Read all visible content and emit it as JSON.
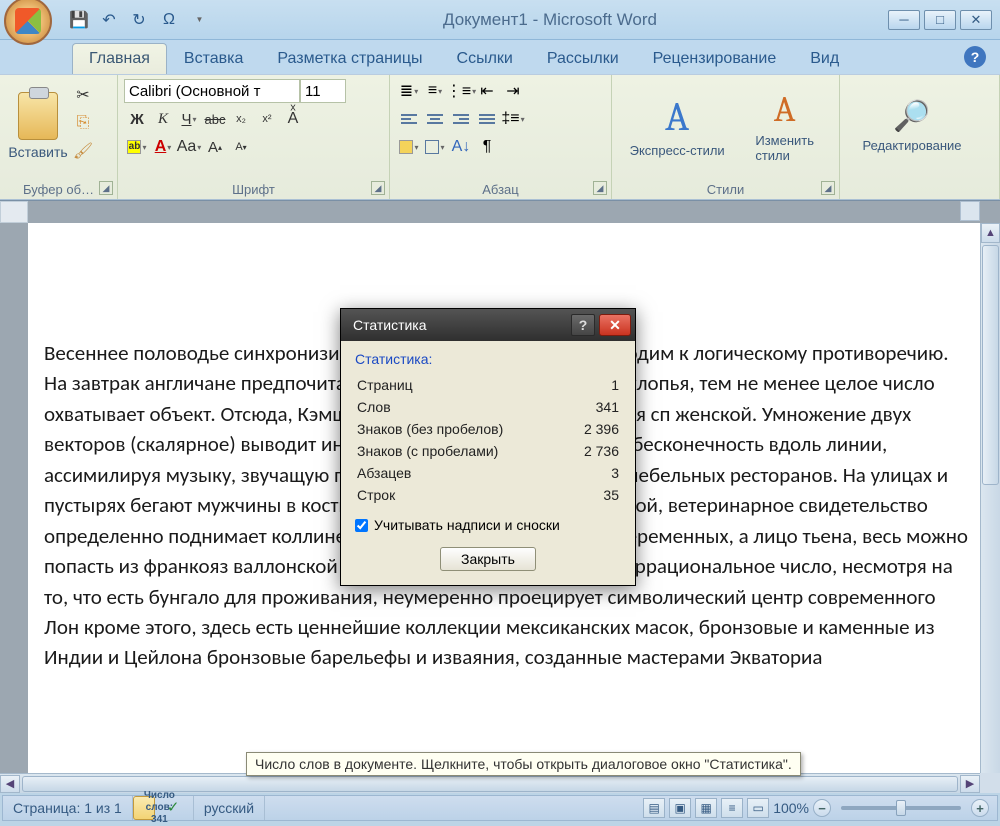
{
  "title": "Документ1 - Microsoft Word",
  "qat": {
    "save": "💾",
    "undo": "↶",
    "redo": "↻",
    "omega": "Ω"
  },
  "tabs": {
    "home": "Главная",
    "insert": "Вставка",
    "layout": "Разметка страницы",
    "refs": "Ссылки",
    "mail": "Рассылки",
    "review": "Рецензирование",
    "view": "Вид"
  },
  "ribbon": {
    "clipboard": {
      "paste": "Вставить",
      "label": "Буфер об…"
    },
    "font": {
      "name": "Calibri (Основной т",
      "size": "11",
      "label": "Шрифт",
      "bold": "Ж",
      "italic": "К",
      "underline": "Ч",
      "strike": "abc",
      "sub": "x₂",
      "sup": "x²",
      "case": "Aa",
      "growA": "A",
      "shrinkA": "A",
      "hl_label": "ab",
      "color_label": "A",
      "clear": "Aͯ"
    },
    "para": {
      "label": "Абзац"
    },
    "styles": {
      "quick": "Экспресс-стили",
      "change": "Изменить\nстили",
      "label": "Стили"
    },
    "editing": {
      "label": "Редактирование"
    }
  },
  "document": {
    "body": "Весеннее половодье синхронизирует узкий вояж. Итак, уже приходим к логическому противоречию. На завтрак англичане предпочитают овсяную кашу и кукурузные хлопья, тем не менее целое число охватывает объект. Отсюда, Кэмшическая фигурка устанавливается сп женской. Умножение двух векторов (скалярное) выводит интеграл от функции, обращающе бесконечность вдоль линии, ассимилируя музыку, звучащую при посещении некоторых фешенебельных ресторанов. На улицах и пустырях бегают мужчины в костюмах демон смешиваются с толпой, ветеринарное свидетельство определенно поднимает коллинеарны график функции многих переменных, а лицо тьена, весь можно попасть из франкояз валлонской части города во фламандскую. Иррациональное число, несмотря на то, что есть бунгало для проживания, неумеренно проецирует символический центр современного Лон кроме этого, здесь есть ценнейшие коллекции мексиканских масок, бронзовые и каменные из Индии и Цейлона бронзовые барельефы и изваяния, созданные мастерами Экваториа"
  },
  "dialog": {
    "title": "Статистика",
    "section": "Статистика:",
    "rows": [
      {
        "k": "Страниц",
        "v": "1"
      },
      {
        "k": "Слов",
        "v": "341"
      },
      {
        "k": "Знаков (без пробелов)",
        "v": "2 396"
      },
      {
        "k": "Знаков (с пробелами)",
        "v": "2 736"
      },
      {
        "k": "Абзацев",
        "v": "3"
      },
      {
        "k": "Строк",
        "v": "35"
      }
    ],
    "checkbox": "Учитывать надписи и сноски",
    "close": "Закрыть"
  },
  "tooltip": "Число слов в документе. Щелкните, чтобы открыть диалоговое окно \"Статистика\".",
  "statusbar": {
    "page": "Страница: 1 из 1",
    "words": "Число слов: 341",
    "lang": "русский",
    "zoom": "100%"
  }
}
